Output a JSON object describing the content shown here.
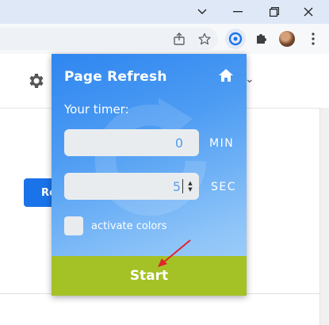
{
  "popup": {
    "title": "Page Refresh",
    "timer_label": "Your timer:",
    "minutes_value": "0",
    "minutes_unit": "MIN",
    "seconds_value": "5",
    "seconds_unit": "SEC",
    "activate_colors_label": "activate colors",
    "start_label": "Start",
    "gradient_color": "#2f86f0",
    "start_color": "#a4c126"
  },
  "page": {
    "button_partial_label": "Re"
  },
  "icons": {
    "window": [
      "chevron-down-icon",
      "minimize-icon",
      "restore-icon",
      "close-icon"
    ],
    "toolbar": [
      "share-icon",
      "star-icon",
      "page-refresh-extension-icon",
      "extensions-puzzle-icon",
      "profile-avatar",
      "menu-kebab-icon"
    ],
    "page": [
      "gear-icon"
    ],
    "popup": [
      "home-icon"
    ]
  }
}
